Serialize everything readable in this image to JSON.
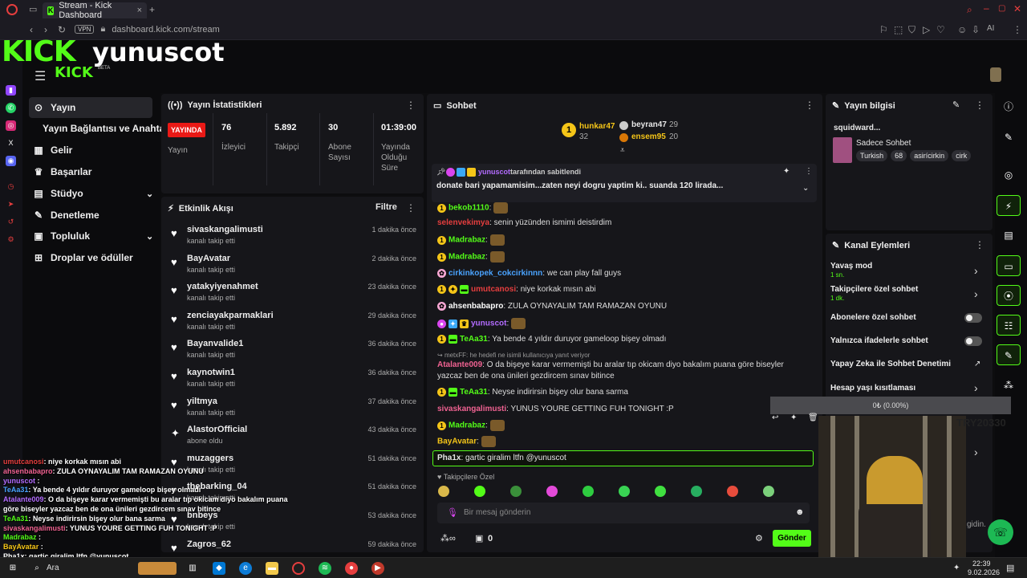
{
  "browser": {
    "tab_title": "Stream - Kick Dashboard",
    "url": "dashboard.kick.com/stream",
    "vpn": "VPN",
    "ai": "AI"
  },
  "header": {
    "brand": "KICK",
    "channel": "yunuscot",
    "logo_small": "KICK",
    "beta": "BETA"
  },
  "nav": {
    "items": [
      {
        "label": "Yayın"
      },
      {
        "label": "Yayın Bağlantısı ve Anahtarı"
      },
      {
        "label": "Gelir"
      },
      {
        "label": "Başarılar"
      },
      {
        "label": "Stüdyo"
      },
      {
        "label": "Denetleme"
      },
      {
        "label": "Topluluk"
      },
      {
        "label": "Droplar ve ödüller"
      }
    ]
  },
  "stats": {
    "title": "Yayın İstatistikleri",
    "live": "YAYINDA",
    "live_label": "Yayın",
    "items": [
      {
        "value": "76",
        "label": "İzleyici"
      },
      {
        "value": "5.892",
        "label": "Takipçi"
      },
      {
        "value": "30",
        "label": "Abone Sayısı"
      },
      {
        "value": "01:39:00",
        "label": "Yayında Olduğu Süre"
      }
    ]
  },
  "activity": {
    "title": "Etkinlik Akışı",
    "filter": "Filtre",
    "items": [
      {
        "name": "sivaskangalimusti",
        "sub": "kanalı takip etti",
        "time": "1 dakika önce"
      },
      {
        "name": "BayAvatar",
        "sub": "kanalı takip etti",
        "time": "2 dakika önce"
      },
      {
        "name": "yatakyiyenahmet",
        "sub": "kanalı takip etti",
        "time": "23 dakika önce"
      },
      {
        "name": "zenciayakparmaklari",
        "sub": "kanalı takip etti",
        "time": "29 dakika önce"
      },
      {
        "name": "Bayanvalide1",
        "sub": "kanalı takip etti",
        "time": "36 dakika önce"
      },
      {
        "name": "kaynotwin1",
        "sub": "kanalı takip etti",
        "time": "36 dakika önce"
      },
      {
        "name": "yiltmya",
        "sub": "kanalı takip etti",
        "time": "37 dakika önce"
      },
      {
        "name": "AlastorOfficial",
        "sub": "abone oldu",
        "time": "43 dakika önce"
      },
      {
        "name": "muzaggers",
        "sub": "kanalı takip etti",
        "time": "51 dakika önce"
      },
      {
        "name": "thebarking_04",
        "sub": "kanalı takip etti",
        "time": "51 dakika önce"
      },
      {
        "name": "bnbeys",
        "sub": "kanalı takip etti",
        "time": "53 dakika önce"
      },
      {
        "name": "Zagros_62",
        "sub": "",
        "time": "59 dakika önce"
      }
    ]
  },
  "chat": {
    "title": "Sohbet",
    "top": [
      {
        "name": "hunkar47",
        "count": "32"
      },
      {
        "name": "beyran47",
        "count": "29"
      },
      {
        "name": "ensem95",
        "count": "20"
      }
    ],
    "pinned_by": "yunuscot",
    "pinned_suffix": "tarafından sabitlendi",
    "pinned_text": "donate bari yapamamisim...zaten neyi dogru yaptim ki.. suanda 120 lirada...",
    "messages": [
      {
        "user": "bekob1110",
        "text": ""
      },
      {
        "user": "selenvekimya",
        "text": "senin yüzünden ismimi deistirdim"
      },
      {
        "user": "Madrabaz",
        "text": ""
      },
      {
        "user": "Madrabaz",
        "text": ""
      },
      {
        "user": "cirkinkopek_cokcirkinnn",
        "text": "we can play fall guys"
      },
      {
        "user": "umutcanosi",
        "text": "niye korkak mısın abi"
      },
      {
        "user": "ahsenbabapro",
        "text": "ZULA OYNAYALIM TAM RAMAZAN OYUNU"
      },
      {
        "user": "yunuscot",
        "text": ""
      },
      {
        "user": "TeAa31",
        "text": "Ya bende 4 yıldır duruyor gameloop bişey olmadı"
      },
      {
        "user": "metxFF",
        "text": "he hedefi ne isimli kullanıcıya yanıt veriyor"
      },
      {
        "user": "Atalante009",
        "text": "O da bişeye karar vermemişti bu aralar tıp okicam diyo bakalım puana göre biseyler yazcaz ben de ona ünileri gezdircem sınav bitince"
      },
      {
        "user": "TeAa31",
        "text": "Neyse indirirsin bişey olur bana sarma"
      },
      {
        "user": "sivaskangalimusti",
        "text": "YUNUS YOURE GETTING FUH TONIGHT :P"
      },
      {
        "user": "Madrabaz",
        "text": ""
      },
      {
        "user": "BayAvatar",
        "text": ""
      },
      {
        "user": "Pha1x",
        "text": "gartic giralim ltfn @yunuscot"
      }
    ],
    "followers_only": "Takipçilere Özel",
    "placeholder": "Bir mesaj gönderin",
    "count": "0",
    "send": "Gönder"
  },
  "info": {
    "title": "Yayın bilgisi",
    "stream_title": "squidward...",
    "category": "Sadece Sohbet",
    "tags": [
      "Turkish",
      "68",
      "asirícirkin",
      "cirk"
    ]
  },
  "actions": {
    "title": "Kanal Eylemleri",
    "items": [
      {
        "label": "Yavaş mod",
        "sub": "1 sn."
      },
      {
        "label": "Takipçilere özel sohbet",
        "sub": "1 dk."
      },
      {
        "label": "Abonelere özel sohbet",
        "sub": ""
      },
      {
        "label": "Yalnızca ifadelerle sohbet",
        "sub": ""
      },
      {
        "label": "Yapay Zeka ile Sohbet Denetimi",
        "sub": ""
      },
      {
        "label": "Hesap yaşı kısıtlaması",
        "sub": ""
      }
    ]
  },
  "overlay": {
    "donate": "0₺ (0.00%)",
    "try": "TRY20330",
    "gidin": "gidin.",
    "chat": [
      {
        "user": "umutcanosi",
        "text": ": niye korkak mısın abi"
      },
      {
        "user": "ahsenbabapro",
        "text": ": ZULA OYNAYALIM TAM RAMAZAN OYUNU"
      },
      {
        "user": "yunuscot",
        "text": " :"
      },
      {
        "user": "TeAa31",
        "text": ": Ya bende 4 yıldır duruyor gameloop bişey olmadı"
      },
      {
        "user": "Atalante009",
        "text": ": O da bişeye karar vermemişti bu aralar tıp okicam diyo bakalım puana"
      },
      {
        "user": "",
        "text": "göre biseyler yazcaz ben de ona ünileri gezdircem sınav bitince"
      },
      {
        "user": "TeAa31",
        "text": ": Neyse indirirsin bişey olur bana sarma"
      },
      {
        "user": "sivaskangalimusti",
        "text": ": YUNUS YOURE GETTING FUH TONIGHT :P"
      },
      {
        "user": "Madrabaz",
        "text": " :"
      },
      {
        "user": "BayAvatar",
        "text": " :"
      },
      {
        "user": "Pha1x",
        "text": ": gartic giralim ltfn @yunuscot"
      }
    ]
  },
  "taskbar": {
    "search": "Ara",
    "time": "22:39",
    "date": "9.02.2026"
  },
  "colors": {
    "accent": "#53fc18",
    "bg": "#0d0d0f",
    "panel": "#16161a"
  }
}
